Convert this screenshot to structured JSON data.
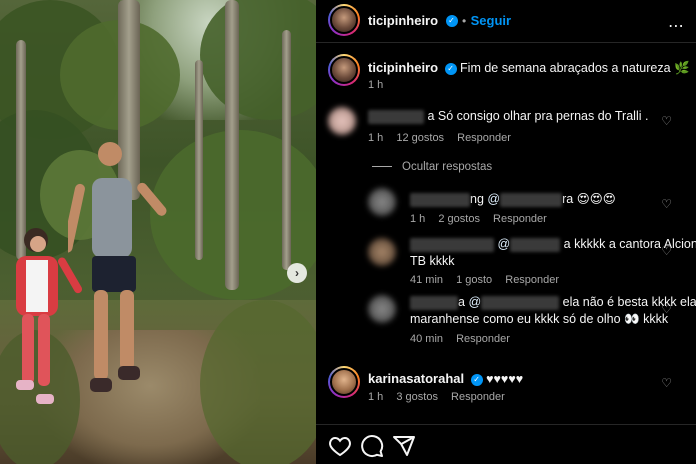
{
  "post": {
    "author": "ticipinheiro",
    "follow_label": "Seguir",
    "separator": "•",
    "caption": "Fim de semana abraçados a natureza",
    "caption_emoji": "🌿",
    "time": "1 h"
  },
  "comments": [
    {
      "user_hidden": true,
      "text_suffix": "a Só consigo olhar pra pernas do Tralli .",
      "time": "1 h",
      "likes": "12 gostos",
      "reply_label": "Responder",
      "toggle_label": "Ocultar respostas"
    },
    {
      "user_suffix": "ng",
      "mention_prefix": "@",
      "text_suffix": "ra",
      "emojis": "😍😍😍",
      "time": "1 h",
      "likes": "2 gostos",
      "reply_label": "Responder"
    },
    {
      "mention_prefix": "@",
      "text": "a kkkkk a cantora Alcione",
      "text_line2": "TB kkkk",
      "time": "41 min",
      "likes": "1 gosto",
      "reply_label": "Responder"
    },
    {
      "user_suffix": "a",
      "mention_prefix": "@",
      "text": "ela não é besta kkkk ela",
      "text_line2": "maranhense como eu kkkk só de olho",
      "text_emoji": "👀",
      "text_end": "kkkk",
      "time": "40 min",
      "reply_label": "Responder"
    },
    {
      "user": "karinasatorahal",
      "text": "♥♥♥♥♥",
      "time": "1 h",
      "likes": "3 gostos",
      "reply_label": "Responder"
    }
  ],
  "icons": [
    "heart-icon",
    "comment-icon",
    "share-icon",
    "more-icon",
    "verified-icon",
    "next-arrow-icon"
  ],
  "colors": {
    "accent": "#0095f6",
    "background": "#000000",
    "muted": "#a8a8a8"
  }
}
